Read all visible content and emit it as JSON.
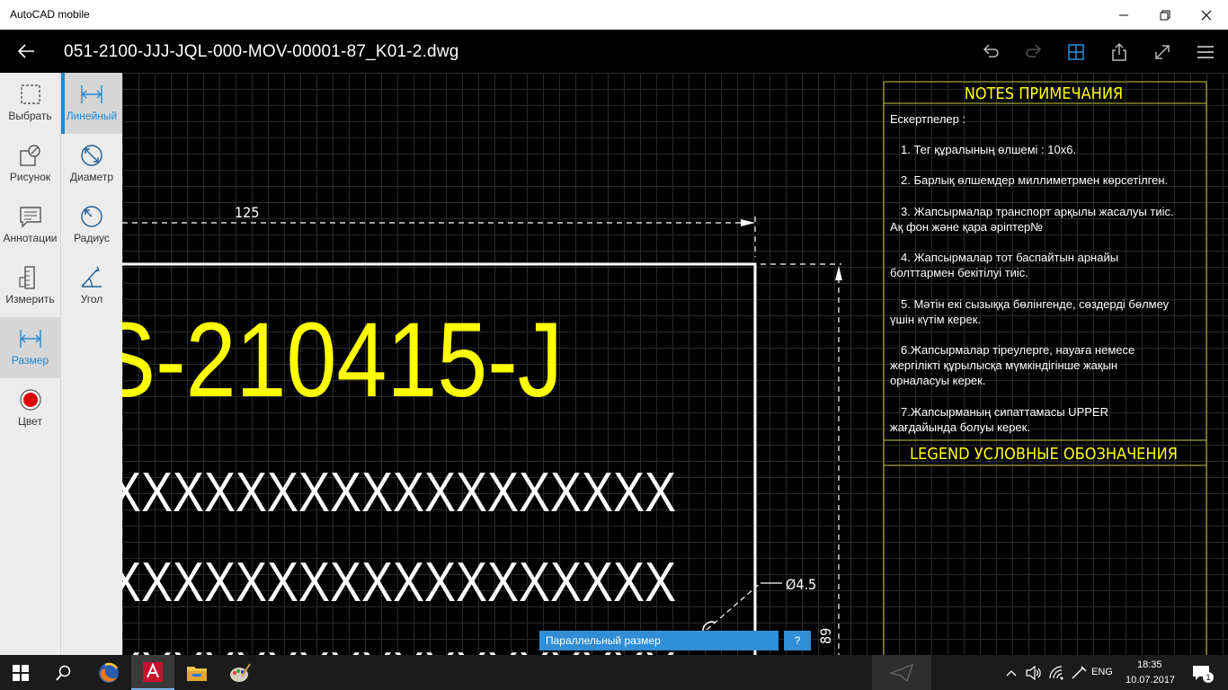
{
  "window": {
    "app_title": "AutoCAD mobile"
  },
  "header": {
    "file_title": "051-2100-JJJ-JQL-000-MOV-00001-87_K01-2.dwg"
  },
  "tools": [
    {
      "label": "Выбрать",
      "icon": "select-icon"
    },
    {
      "label": "Рисунок",
      "icon": "draw-icon"
    },
    {
      "label": "Аннотации",
      "icon": "annotation-icon"
    },
    {
      "label": "Измерить",
      "icon": "measure-icon"
    },
    {
      "label": "Размер",
      "icon": "dimension-icon"
    },
    {
      "label": "Цвет",
      "icon": "color-icon"
    }
  ],
  "subtools": [
    {
      "label": "Линейный",
      "icon": "linear-dimension-icon"
    },
    {
      "label": "Диаметр",
      "icon": "diameter-icon"
    },
    {
      "label": "Радиус",
      "icon": "radius-icon"
    },
    {
      "label": "Угол",
      "icon": "angle-icon"
    }
  ],
  "drawing": {
    "dim_top": "125",
    "diameter": "Ø4.5",
    "dim_right": "89",
    "big_text": "S-210415-J",
    "x_row": "XXXXXXXXXXXXXXXXXX",
    "notes_title": "NOTES  ПРИМЕЧАНИЯ",
    "notes_intro": "Ескертпелер :",
    "notes": [
      "1. Тег құралының өлшемі : 10x6.",
      "2. Барлық өлшемдер миллиметрмен көрсетілген.",
      "3. Жапсырмалар транспорт арқылы жасалуы тиіс.\nАқ фон және қара әріптер№",
      "4. Жапсырмалар тот баспайтын арнайы\nболттармен бекітілуі тиіс.",
      "5. Мәтін екі сызыққа бөлінгенде, сөздерді бөлмеу\nүшін күтім керек.",
      "6.Жапсырмалар тіреулерге, науаға немесе\nжергілікті құрылысқа мүмкіндігінше жақын\nорналасуы керек.",
      "7.Жапсырманың сипаттамасы UPPER\nжағдайында болуы керек."
    ],
    "legend_title": "LEGEND  УСЛОВНЫЕ ОБОЗНАЧЕНИЯ"
  },
  "tooltip": {
    "text": "Параллельный размер",
    "help": "?"
  },
  "colors": {
    "accent": "#1e88d2",
    "cad_yellow": "#ffff00",
    "frame_yellow": "#c8c840"
  },
  "taskbar": {
    "lang": "ENG",
    "time": "18:35",
    "date": "10.07.2017",
    "notifications": "1"
  }
}
